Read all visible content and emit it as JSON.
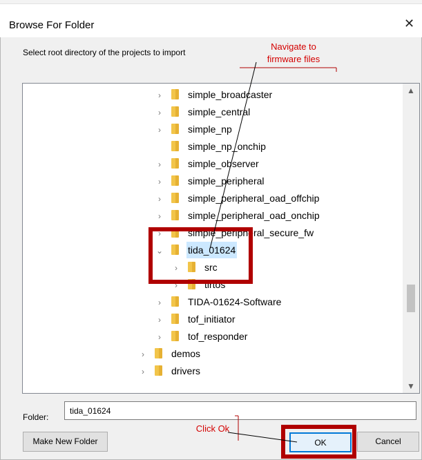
{
  "dialog": {
    "title": "Browse For Folder",
    "close_glyph": "✕",
    "instruction": "Select root directory of the projects to import"
  },
  "tree": {
    "items": [
      {
        "label": "simple_broadcaster",
        "indent": 1,
        "toggle": "collapsed"
      },
      {
        "label": "simple_central",
        "indent": 1,
        "toggle": "collapsed"
      },
      {
        "label": "simple_np",
        "indent": 1,
        "toggle": "collapsed"
      },
      {
        "label": "simple_np_onchip",
        "indent": 1,
        "toggle": "none"
      },
      {
        "label": "simple_observer",
        "indent": 1,
        "toggle": "collapsed"
      },
      {
        "label": "simple_peripheral",
        "indent": 1,
        "toggle": "collapsed"
      },
      {
        "label": "simple_peripheral_oad_offchip",
        "indent": 1,
        "toggle": "collapsed"
      },
      {
        "label": "simple_peripheral_oad_onchip",
        "indent": 1,
        "toggle": "collapsed"
      },
      {
        "label": "simple_peripheral_secure_fw",
        "indent": 1,
        "toggle": "collapsed"
      },
      {
        "label": "tida_01624",
        "indent": 1,
        "toggle": "expanded",
        "selected": true
      },
      {
        "label": "src",
        "indent": 2,
        "toggle": "collapsed"
      },
      {
        "label": "tirtos",
        "indent": 2,
        "toggle": "collapsed"
      },
      {
        "label": "TIDA-01624-Software",
        "indent": 1,
        "toggle": "collapsed"
      },
      {
        "label": "tof_initiator",
        "indent": 1,
        "toggle": "collapsed"
      },
      {
        "label": "tof_responder",
        "indent": 1,
        "toggle": "collapsed"
      },
      {
        "label": "demos",
        "indent": 0,
        "toggle": "collapsed"
      },
      {
        "label": "drivers",
        "indent": 0,
        "toggle": "collapsed"
      }
    ],
    "scroll_up_glyph": "▲",
    "scroll_down_glyph": "▼"
  },
  "folder": {
    "label": "Folder:",
    "value": "tida_01624"
  },
  "buttons": {
    "make_new_folder": "Make New Folder",
    "ok": "OK",
    "cancel": "Cancel"
  },
  "annotations": {
    "navigate_line1": "Navigate to",
    "navigate_line2": "firmware files",
    "click_ok": "Click Ok",
    "color": "#b00000"
  },
  "icons": {
    "collapsed": "›",
    "expanded": "⌄",
    "folder": "folder-icon"
  }
}
